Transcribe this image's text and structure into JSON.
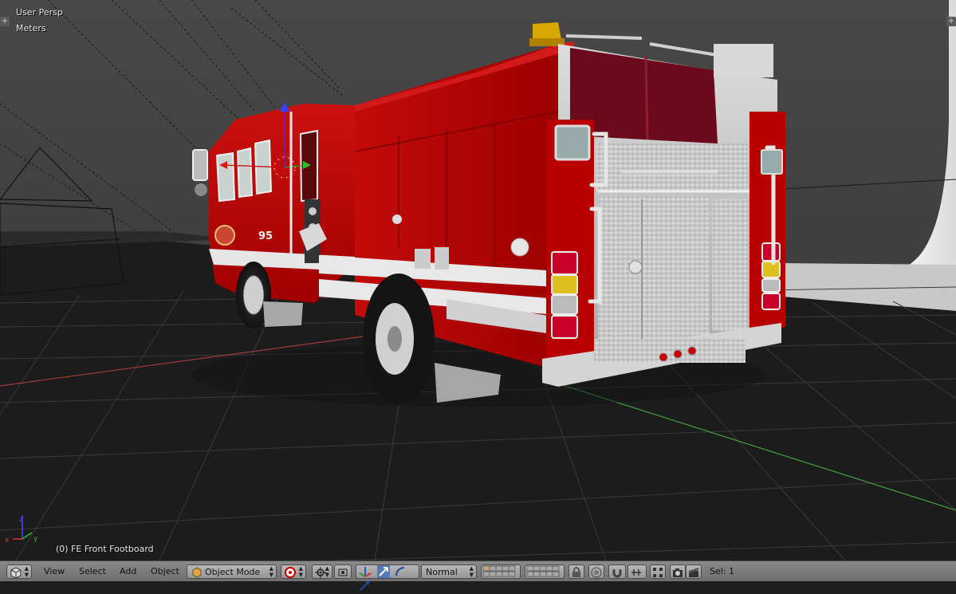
{
  "viewport": {
    "view_label": "User Persp",
    "units_label": "Meters",
    "active_object_label": "(0) FE Front Footboard",
    "corner_left": "+",
    "corner_right": "+",
    "truck_number": "95",
    "axis_labels": {
      "x": "x",
      "y": "y",
      "z": "z"
    }
  },
  "header": {
    "editor_type_icon": "3d-view-icon",
    "menus": {
      "view": "View",
      "select": "Select",
      "add": "Add",
      "object": "Object"
    },
    "mode": {
      "label": "Object Mode",
      "icon": "cube-icon"
    },
    "pivot_icon": "pivot-point-icon",
    "manipulator_icons": [
      "manipulator-icon",
      "translate-icon",
      "rotate-icon",
      "scale-icon"
    ],
    "orientation": {
      "label": "Normal"
    },
    "layers_icon": "layer-grid-icon",
    "snap_icons": [
      "lock-icon",
      "proportional-edit-icon",
      "magnet-icon",
      "snap-element-icon"
    ],
    "render_icons": [
      "render-preview-icon",
      "camera-icon",
      "clapper-icon"
    ],
    "selection_count": "Sel: 1"
  },
  "colors": {
    "viewport_bg": "#3d3d3d",
    "floor": "#1d1d1d",
    "truck_red": "#b80000",
    "header_bg": "#7d7d7d",
    "x_axis": "#a23a3a",
    "y_axis": "#3ea33e"
  }
}
